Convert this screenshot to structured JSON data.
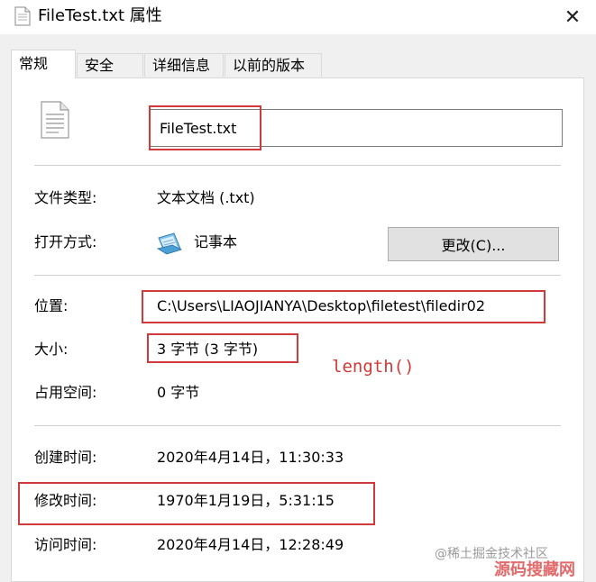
{
  "window": {
    "title": "FileTest.txt 属性",
    "close_glyph": "✕"
  },
  "tabs": [
    {
      "label": "常规",
      "active": true
    },
    {
      "label": "安全",
      "active": false
    },
    {
      "label": "详细信息",
      "active": false
    },
    {
      "label": "以前的版本",
      "active": false
    }
  ],
  "general": {
    "file_name": "FileTest.txt",
    "type_label": "文件类型:",
    "type_value": "文本文档 (.txt)",
    "open_with_label": "打开方式:",
    "open_with_value": "记事本",
    "change_button": "更改(C)...",
    "location_label": "位置:",
    "location_value": "C:\\Users\\LIAOJIANYA\\Desktop\\filetest\\filedir02",
    "size_label": "大小:",
    "size_value": "3 字节 (3 字节)",
    "disk_size_label": "占用空间:",
    "disk_size_value": "0 字节",
    "created_label": "创建时间:",
    "created_value": "2020年4月14日，11:30:33",
    "modified_label": "修改时间:",
    "modified_value": "1970年1月19日，5:31:15",
    "accessed_label": "访问时间:",
    "accessed_value": "2020年4月14日，12:28:49"
  },
  "annotation": {
    "note": "length()",
    "color": "#d03a3a"
  },
  "watermarks": {
    "line1": "@稀土掘金技术社区",
    "line2": "源码搜藏网"
  },
  "icons": {
    "title": "document-icon",
    "file": "text-file-icon",
    "open_with": "notepad-icon",
    "close": "close-icon"
  }
}
